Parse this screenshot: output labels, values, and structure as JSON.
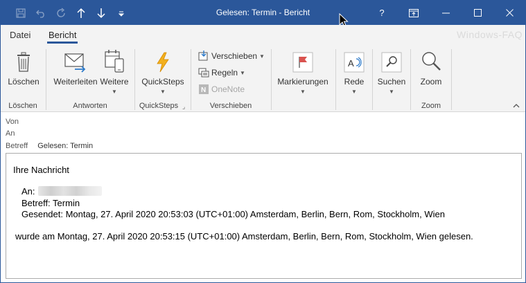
{
  "window": {
    "title": "Gelesen: Termin  -  Bericht",
    "help_label": "?",
    "controls": [
      "restore-ribbon",
      "minimize",
      "maximize",
      "close"
    ]
  },
  "quick_access": [
    {
      "icon": "save-icon",
      "enabled": false
    },
    {
      "icon": "undo-icon",
      "enabled": false
    },
    {
      "icon": "redo-icon",
      "enabled": false
    },
    {
      "icon": "arrow-up-icon",
      "enabled": true
    },
    {
      "icon": "arrow-down-icon",
      "enabled": true
    },
    {
      "icon": "customize-qat-icon",
      "enabled": true
    }
  ],
  "tabs": [
    {
      "label": "Datei",
      "active": false
    },
    {
      "label": "Bericht",
      "active": true
    }
  ],
  "watermark": "Windows-FAQ",
  "ribbon": {
    "groups": {
      "loeschen": {
        "label": "Löschen",
        "buttons": [
          {
            "label": "Löschen",
            "icon": "trash-icon"
          }
        ]
      },
      "antworten": {
        "label": "Antworten",
        "buttons": [
          {
            "label": "Weiterleiten",
            "icon": "forward-mail-icon"
          },
          {
            "label": "Weitere",
            "icon": "more-respond-icon",
            "dropdown": true
          }
        ]
      },
      "quicksteps": {
        "label": "QuickSteps",
        "buttons": [
          {
            "label": "QuickSteps",
            "icon": "lightning-icon",
            "dropdown": true
          }
        ]
      },
      "verschieben": {
        "label": "Verschieben",
        "buttons": [
          {
            "label": "Verschieben",
            "icon": "move-icon",
            "dropdown": true,
            "enabled": true
          },
          {
            "label": "Regeln",
            "icon": "rules-icon",
            "dropdown": true,
            "enabled": true
          },
          {
            "label": "OneNote",
            "icon": "onenote-icon",
            "enabled": false
          }
        ]
      },
      "markierungen": {
        "buttons": [
          {
            "label": "Markierungen",
            "icon": "flag-icon",
            "dropdown": true
          }
        ]
      },
      "rede": {
        "buttons": [
          {
            "label": "Rede",
            "icon": "read-aloud-icon",
            "dropdown": true
          }
        ]
      },
      "suchen": {
        "buttons": [
          {
            "label": "Suchen",
            "icon": "find-icon",
            "dropdown": true
          }
        ]
      },
      "zoom": {
        "label": "Zoom",
        "buttons": [
          {
            "label": "Zoom",
            "icon": "magnifier-icon"
          }
        ]
      }
    }
  },
  "header": {
    "von_label": "Von",
    "an_label": "An",
    "betreff_label": "Betreff",
    "betreff_value": "Gelesen: Termin"
  },
  "message": {
    "intro": "Ihre Nachricht",
    "an_label": "An:",
    "betreff_line": "Betreff: Termin",
    "gesendet_line": "Gesendet: Montag, 27. April 2020 20:53:03 (UTC+01:00) Amsterdam, Berlin, Bern, Rom, Stockholm, Wien",
    "read_line": "wurde am Montag, 27. April 2020 20:53:15 (UTC+01:00) Amsterdam, Berlin, Bern, Rom, Stockholm, Wien gelesen."
  }
}
